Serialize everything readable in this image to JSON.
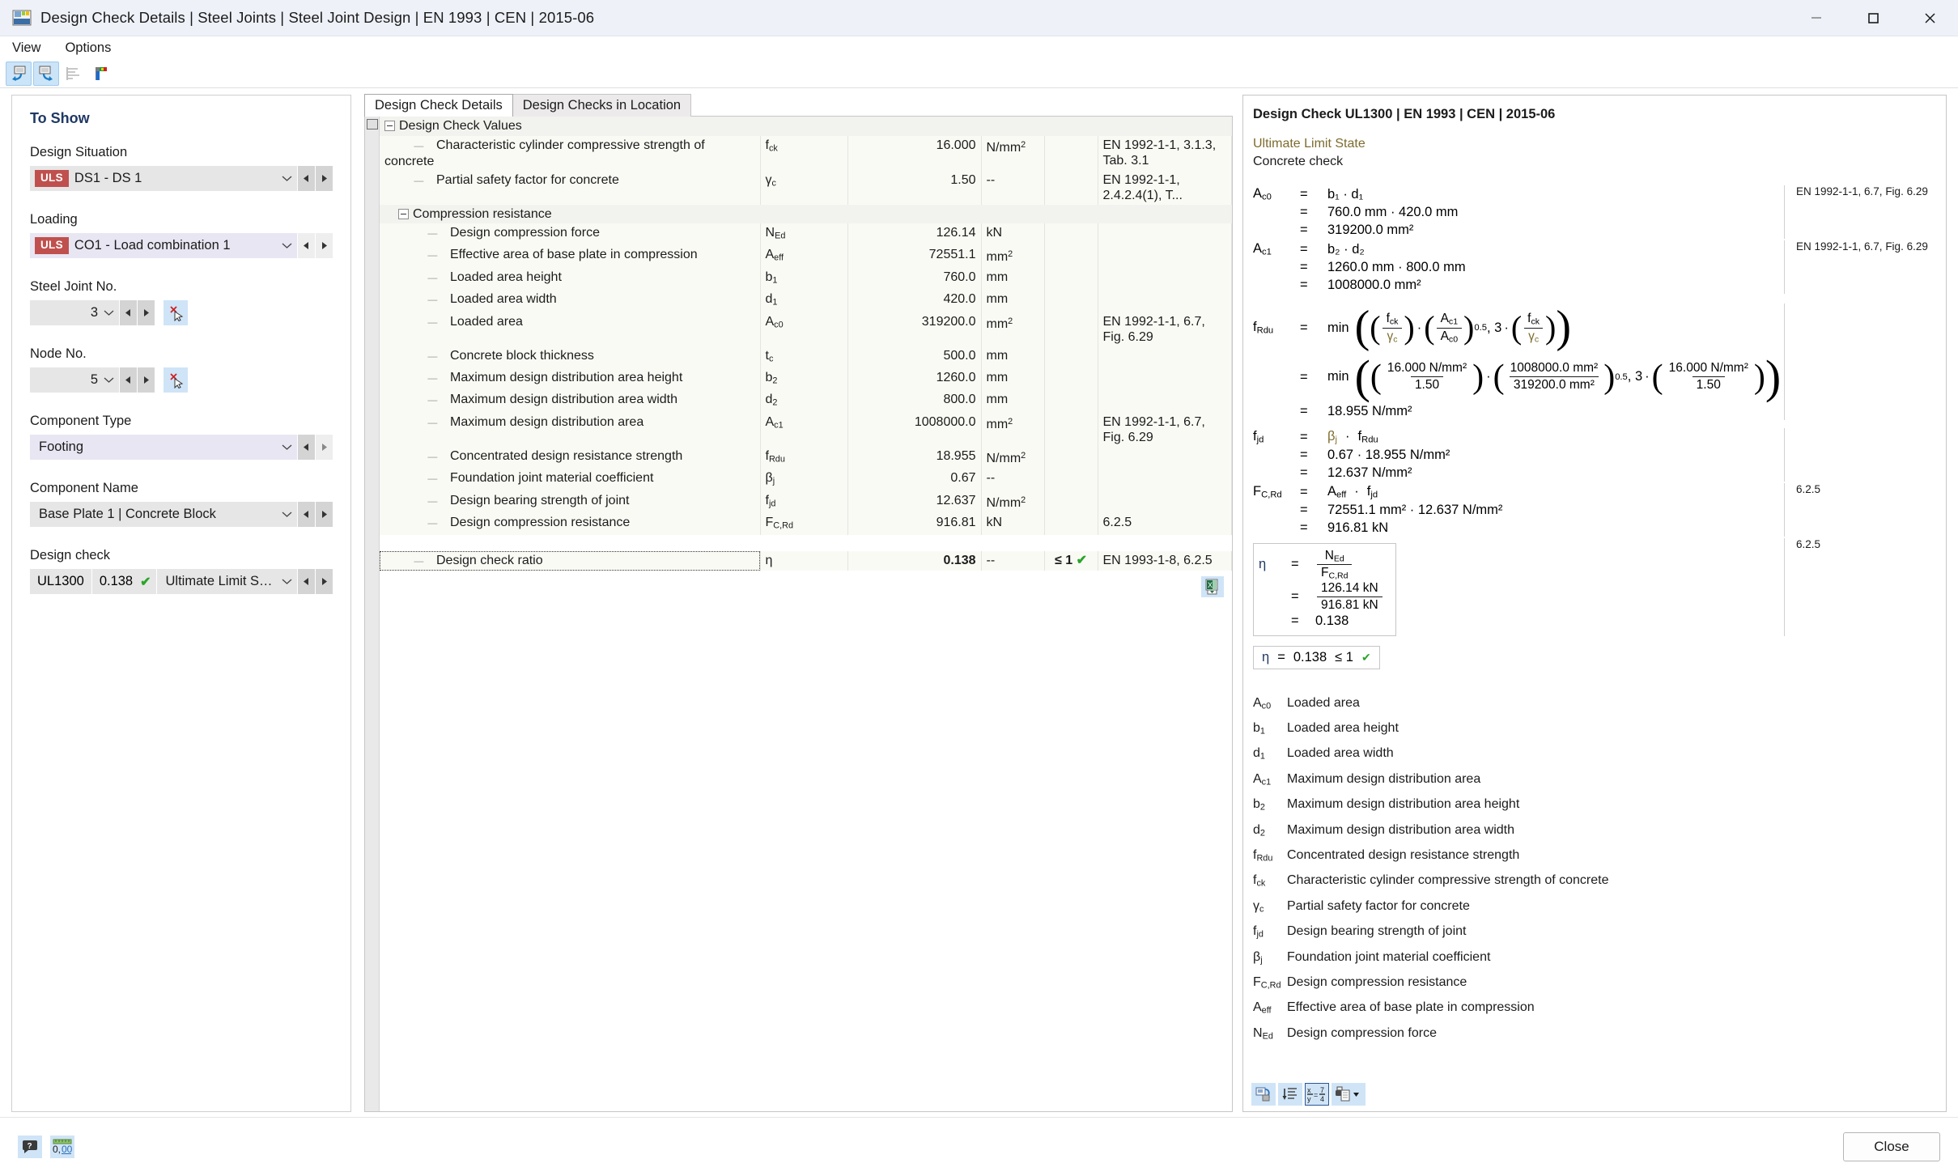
{
  "window": {
    "title": "Design Check Details | Steel Joints | Steel Joint Design | EN 1993 | CEN | 2015-06",
    "minimize": "—",
    "maximize": "☐",
    "close": "✕"
  },
  "menu": {
    "items": [
      "View",
      "Options"
    ]
  },
  "toolbar": {
    "buttons": [
      {
        "name": "previous-detail-icon",
        "active": true
      },
      {
        "name": "next-detail-icon",
        "active": true
      },
      {
        "name": "result-diagram-icon",
        "active": false
      },
      {
        "name": "color-render-icon",
        "active": false
      }
    ]
  },
  "sidebar": {
    "panel_title": "To Show",
    "design_situation": {
      "label": "Design Situation",
      "badge": "ULS",
      "value": "DS1 - DS 1"
    },
    "loading": {
      "label": "Loading",
      "badge": "ULS",
      "value": "CO1 - Load combination 1"
    },
    "steel_joint_no": {
      "label": "Steel Joint No.",
      "value": "3"
    },
    "node_no": {
      "label": "Node No.",
      "value": "5"
    },
    "component_type": {
      "label": "Component Type",
      "value": "Footing"
    },
    "component_name": {
      "label": "Component Name",
      "value": "Base Plate 1 | Concrete Block"
    },
    "design_check": {
      "label": "Design check",
      "id": "UL1300",
      "ratio": "0.138",
      "check": "✔",
      "description": "Ultimate Limit State | C..."
    }
  },
  "center": {
    "tabs": [
      {
        "label": "Design Check Details",
        "active": true
      },
      {
        "label": "Design Checks in Location",
        "active": false
      }
    ],
    "root_group": "Design Check Values",
    "rows": [
      {
        "type": "value",
        "indent": 2,
        "desc": "Characteristic cylinder compressive strength of concrete",
        "sym": "f",
        "sub": "ck",
        "val": "16.000",
        "unit": "N/mm",
        "unit_sup": "2",
        "ref": "EN 1992-1-1, 3.1.3, Tab. 3.1"
      },
      {
        "type": "value",
        "indent": 2,
        "desc": "Partial safety factor for concrete",
        "sym": "γ",
        "sub": "c",
        "val": "1.50",
        "unit": "--",
        "unit_sup": "",
        "ref": "EN 1992-1-1, 2.4.2.4(1), T..."
      },
      {
        "type": "group",
        "indent": 1,
        "desc": "Compression resistance"
      },
      {
        "type": "value",
        "indent": 3,
        "desc": "Design compression force",
        "sym": "N",
        "sub": "Ed",
        "val": "126.14",
        "unit": "kN",
        "unit_sup": "",
        "ref": ""
      },
      {
        "type": "value",
        "indent": 3,
        "desc": "Effective area of base plate in compression",
        "sym": "A",
        "sub": "eff",
        "val": "72551.1",
        "unit": "mm",
        "unit_sup": "2",
        "ref": ""
      },
      {
        "type": "value",
        "indent": 3,
        "desc": "Loaded area height",
        "sym": "b",
        "sub": "1",
        "val": "760.0",
        "unit": "mm",
        "unit_sup": "",
        "ref": ""
      },
      {
        "type": "value",
        "indent": 3,
        "desc": "Loaded area width",
        "sym": "d",
        "sub": "1",
        "val": "420.0",
        "unit": "mm",
        "unit_sup": "",
        "ref": ""
      },
      {
        "type": "value",
        "indent": 3,
        "desc": "Loaded area",
        "sym": "A",
        "sub": "c0",
        "val": "319200.0",
        "unit": "mm",
        "unit_sup": "2",
        "ref": "EN 1992-1-1, 6.7, Fig. 6.29"
      },
      {
        "type": "value",
        "indent": 3,
        "desc": "Concrete block thickness",
        "sym": "t",
        "sub": "c",
        "val": "500.0",
        "unit": "mm",
        "unit_sup": "",
        "ref": ""
      },
      {
        "type": "value",
        "indent": 3,
        "desc": "Maximum design distribution area height",
        "sym": "b",
        "sub": "2",
        "val": "1260.0",
        "unit": "mm",
        "unit_sup": "",
        "ref": ""
      },
      {
        "type": "value",
        "indent": 3,
        "desc": "Maximum design distribution area width",
        "sym": "d",
        "sub": "2",
        "val": "800.0",
        "unit": "mm",
        "unit_sup": "",
        "ref": ""
      },
      {
        "type": "value",
        "indent": 3,
        "desc": "Maximum design distribution area",
        "sym": "A",
        "sub": "c1",
        "val": "1008000.0",
        "unit": "mm",
        "unit_sup": "2",
        "ref": "EN 1992-1-1, 6.7, Fig. 6.29"
      },
      {
        "type": "value",
        "indent": 3,
        "desc": "Concentrated design resistance strength",
        "sym": "f",
        "sub": "Rdu",
        "val": "18.955",
        "unit": "N/mm",
        "unit_sup": "2",
        "ref": ""
      },
      {
        "type": "value",
        "indent": 3,
        "desc": "Foundation joint material coefficient",
        "sym": "β",
        "sub": "j",
        "val": "0.67",
        "unit": "--",
        "unit_sup": "",
        "ref": ""
      },
      {
        "type": "value",
        "indent": 3,
        "desc": "Design bearing strength of joint",
        "sym": "f",
        "sub": "jd",
        "val": "12.637",
        "unit": "N/mm",
        "unit_sup": "2",
        "ref": ""
      },
      {
        "type": "value",
        "indent": 3,
        "desc": "Design compression resistance",
        "sym": "F",
        "sub": "C,Rd",
        "val": "916.81",
        "unit": "kN",
        "unit_sup": "",
        "ref": "6.2.5"
      }
    ],
    "ratio_row": {
      "desc": "Design check ratio",
      "sym": "η",
      "sub": "",
      "val": "0.138",
      "unit": "--",
      "cmp": "≤ 1",
      "check": "✔",
      "ref": "EN 1993-1-8, 6.2.5"
    },
    "export_button": "excel-export-icon"
  },
  "detail": {
    "title": "Design Check UL1300 | EN 1993 | CEN | 2015-06",
    "subtitle_1": "Ultimate Limit State",
    "subtitle_2": "Concrete check",
    "refs": {
      "fig629": "EN 1992-1-1, 6.7, Fig. 6.29",
      "s625": "6.2.5"
    },
    "ac0": {
      "sym": "A",
      "sub": "c0",
      "line1": "b₁ · d₁",
      "line2": "760.0 mm · 420.0 mm",
      "line3": "319200.0 mm²"
    },
    "ac1": {
      "sym": "A",
      "sub": "c1",
      "line1": "b₂ · d₂",
      "line2": "1260.0 mm · 800.0 mm",
      "line3": "1008000.0 mm²"
    },
    "frdu": {
      "sym": "f",
      "sub": "Rdu",
      "fn": "min",
      "num1": "f",
      "num1sub": "ck",
      "den1": "γ",
      "den1sub": "c",
      "num2": "A",
      "num2sub": "c1",
      "den2": "A",
      "den2sub": "c0",
      "exp": "0.5",
      "factor": "3",
      "v_num1": "16.000 N/mm²",
      "v_den1": "1.50",
      "v_num2": "1008000.0 mm²",
      "v_den2": "319200.0 mm²",
      "v_num3": "16.000 N/mm²",
      "v_den3": "1.50",
      "result": "18.955 N/mm²"
    },
    "fjd": {
      "sym": "f",
      "sub": "jd",
      "line1a": "β",
      "line1asub": "j",
      "line1b": "f",
      "line1bsub": "Rdu",
      "line2": "0.67 · 18.955 N/mm²",
      "line3": "12.637 N/mm²"
    },
    "fcrd": {
      "sym": "F",
      "sub": "C,Rd",
      "line1a": "A",
      "line1asub": "eff",
      "line1b": "f",
      "line1bsub": "jd",
      "line2": "72551.1 mm² · 12.637 N/mm²",
      "line3": "916.81 kN"
    },
    "eta": {
      "sym": "η",
      "num_sym": "N",
      "num_sub": "Ed",
      "den_sym": "F",
      "den_sub": "C,Rd",
      "num_val": "126.14 kN",
      "den_val": "916.81 kN",
      "result": "0.138"
    },
    "eta_result": {
      "sym": "η",
      "eq": "=",
      "value": "0.138",
      "cmp": "≤ 1",
      "check": "✔"
    },
    "nomenclature": [
      {
        "sym": "A",
        "sub": "c0",
        "desc": "Loaded area"
      },
      {
        "sym": "b",
        "sub": "1",
        "desc": "Loaded area height"
      },
      {
        "sym": "d",
        "sub": "1",
        "desc": "Loaded area width"
      },
      {
        "sym": "A",
        "sub": "c1",
        "desc": "Maximum design distribution area"
      },
      {
        "sym": "b",
        "sub": "2",
        "desc": "Maximum design distribution area height"
      },
      {
        "sym": "d",
        "sub": "2",
        "desc": "Maximum design distribution area width"
      },
      {
        "sym": "f",
        "sub": "Rdu",
        "desc": "Concentrated design resistance strength"
      },
      {
        "sym": "f",
        "sub": "ck",
        "desc": "Characteristic cylinder compressive strength of concrete"
      },
      {
        "sym": "γ",
        "sub": "c",
        "desc": "Partial safety factor for concrete"
      },
      {
        "sym": "f",
        "sub": "jd",
        "desc": "Design bearing strength of joint"
      },
      {
        "sym": "β",
        "sub": "j",
        "desc": "Foundation joint material coefficient"
      },
      {
        "sym": "F",
        "sub": "C,Rd",
        "desc": "Design compression resistance"
      },
      {
        "sym": "A",
        "sub": "eff",
        "desc": "Effective area of base plate in compression"
      },
      {
        "sym": "N",
        "sub": "Ed",
        "desc": "Design compression force"
      }
    ],
    "toolbar": [
      {
        "name": "reset-view-icon",
        "selected": false
      },
      {
        "name": "list-details-icon",
        "selected": false
      },
      {
        "name": "formula-toggle-icon",
        "selected": true
      },
      {
        "name": "print-document-icon",
        "selected": false
      }
    ]
  },
  "footer": {
    "help_icon": "help-balloon-icon",
    "units_icon": "units-decimal-icon",
    "close_label": "Close"
  },
  "colors": {
    "accent": "#cfe4f7",
    "badge": "#c0504d",
    "ok": "#2aa52a",
    "title": "#1f3864",
    "gold": "#7d6c2e"
  }
}
